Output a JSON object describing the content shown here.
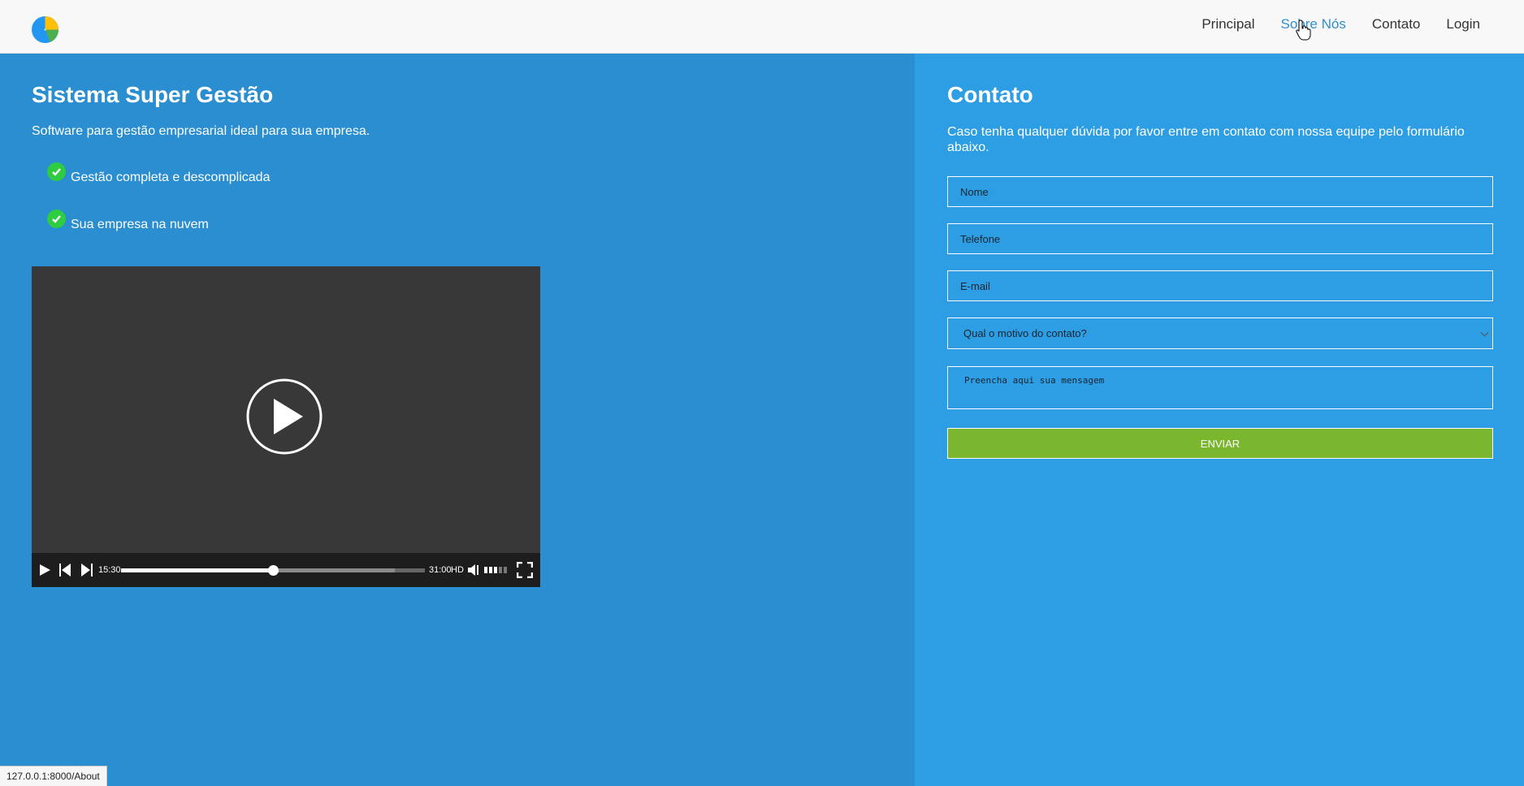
{
  "nav": {
    "items": [
      {
        "label": "Principal"
      },
      {
        "label": "Sobre Nós",
        "active": true
      },
      {
        "label": "Contato"
      },
      {
        "label": "Login"
      }
    ]
  },
  "hero": {
    "title": "Sistema Super Gestão",
    "description": "Software para gestão empresarial ideal para sua empresa.",
    "features": [
      "Gestão completa e descomplicada",
      "Sua empresa na nuvem"
    ]
  },
  "video": {
    "current_time": "15:30",
    "duration": "31:00",
    "quality": "HD",
    "progress_fraction": 0.5,
    "buffer_fraction": 0.9
  },
  "contact": {
    "title": "Contato",
    "description": "Caso tenha qualquer dúvida por favor entre em contato com nossa equipe pelo formulário abaixo.",
    "name_placeholder": "Nome",
    "phone_placeholder": "Telefone",
    "email_placeholder": "E-mail",
    "reason_selected": "Qual o motivo do contato?",
    "message_placeholder": "Preencha aqui sua mensagem",
    "submit_label": "ENVIAR"
  },
  "status_bar": {
    "url": "127.0.0.1:8000/About"
  },
  "colors": {
    "left_bg": "#2a8ed0",
    "right_bg": "#2d9ee4",
    "submit_bg": "#7ab62e",
    "nav_active": "#2f8fce",
    "check_green": "#2ecc40"
  }
}
